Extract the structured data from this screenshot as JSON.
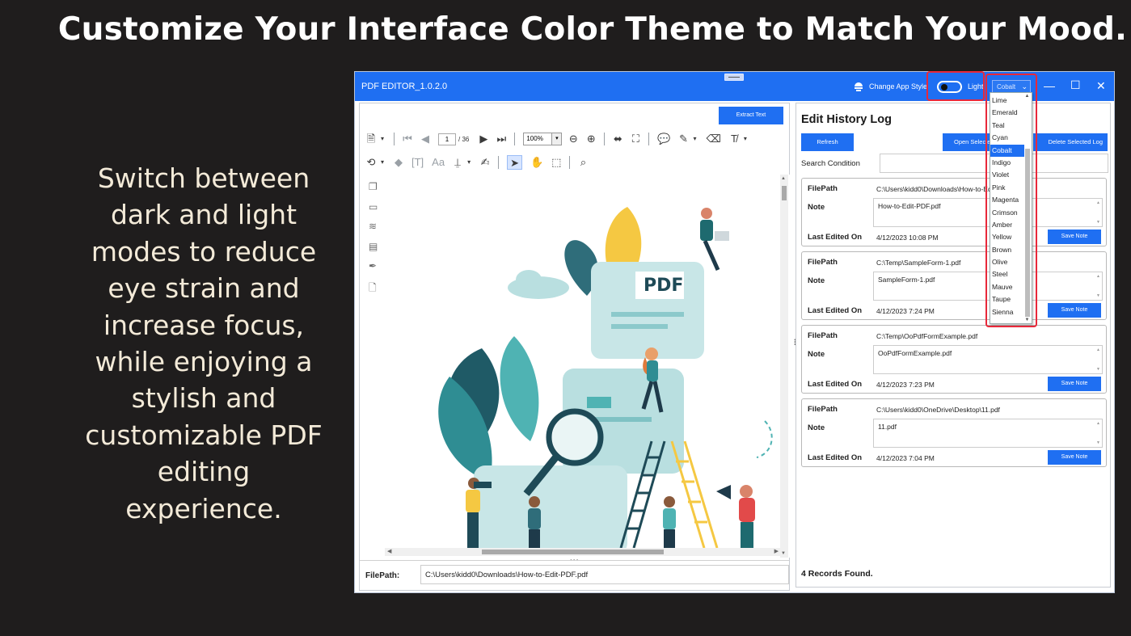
{
  "headline": "Customize Your Interface Color Theme to Match Your Mood.",
  "blurb_lines": [
    "Switch between",
    "dark and light",
    "modes to reduce",
    "eye strain and",
    "increase focus,",
    "while enjoying a",
    "stylish and",
    "customizable PDF",
    "editing experience."
  ],
  "window": {
    "title": "PDF EDITOR_1.0.2.0",
    "change_style_label": "Change App Style",
    "mode_label": "Light",
    "theme_selected": "Cobalt",
    "minimize": "—",
    "maximize": "☐",
    "close": "✕"
  },
  "themes": [
    "Lime",
    "Emerald",
    "Teal",
    "Cyan",
    "Cobalt",
    "Indigo",
    "Violet",
    "Pink",
    "Magenta",
    "Crimson",
    "Amber",
    "Yellow",
    "Brown",
    "Olive",
    "Steel",
    "Mauve",
    "Taupe",
    "Sienna"
  ],
  "toolbar": {
    "extract_text": "Extract Text",
    "current_page": "1",
    "page_total": "/ 36",
    "zoom": "100%"
  },
  "viewer": {
    "pdf_badge": "PDF",
    "filepath_label": "FilePath:",
    "filepath_value": "C:\\Users\\kidd0\\Downloads\\How-to-Edit-PDF.pdf"
  },
  "history": {
    "title": "Edit History Log",
    "refresh": "Refresh",
    "open_selected": "Open Selected",
    "delete_selected": "Delete Selected Log",
    "search_label": "Search Condition",
    "filepath_label": "FilePath",
    "note_label": "Note",
    "last_edited_label": "Last Edited On",
    "save_note": "Save Note",
    "records": [
      {
        "filepath": "C:\\Users\\kidd0\\Downloads\\How-to-Edit-PDF.pdf",
        "note": "How-to-Edit-PDF.pdf",
        "last_edited": "4/12/2023 10:08 PM"
      },
      {
        "filepath": "C:\\Temp\\SampleForm-1.pdf",
        "note": "SampleForm-1.pdf",
        "last_edited": "4/12/2023 7:24 PM"
      },
      {
        "filepath": "C:\\Temp\\OoPdfFormExample.pdf",
        "note": "OoPdfFormExample.pdf",
        "last_edited": "4/12/2023 7:23 PM"
      },
      {
        "filepath": "C:\\Users\\kidd0\\OneDrive\\Desktop\\11.pdf",
        "note": "11.pdf",
        "last_edited": "4/12/2023 7:04 PM"
      }
    ],
    "records_found": "4 Records Found."
  },
  "colors": {
    "background": "#1f1d1d",
    "accent": "#1f6ff2",
    "highlight": "#e8283a",
    "blurb": "#f3ead8"
  }
}
